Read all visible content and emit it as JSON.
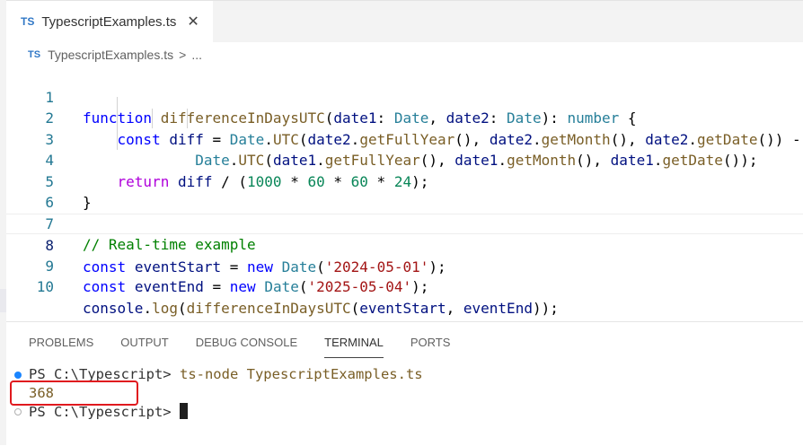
{
  "editor_tab": {
    "lang_badge": "TS",
    "filename": "TypescriptExamples.ts",
    "close_glyph": "✕"
  },
  "breadcrumb": {
    "lang_badge": "TS",
    "file": "TypescriptExamples.ts",
    "separator": ">",
    "more": "..."
  },
  "code": {
    "line_numbers": [
      "1",
      "2",
      "3",
      "4",
      "5",
      "6",
      "7",
      "8",
      "9",
      "10"
    ],
    "active_line": 8
  },
  "panel": {
    "tabs": [
      "PROBLEMS",
      "OUTPUT",
      "DEBUG CONSOLE",
      "TERMINAL",
      "PORTS"
    ],
    "active_tab": "TERMINAL"
  },
  "terminal": {
    "prompt": "PS C:\\Typescript>",
    "command": "ts-node TypescriptExamples.ts",
    "output": "368",
    "prompt2": "PS C:\\Typescript>"
  },
  "colors": {
    "keyword": "#0000ff",
    "function": "#795e26",
    "type": "#267f99",
    "string": "#a31515",
    "number": "#098658",
    "comment": "#008000",
    "highlight_box": "#e0191e"
  }
}
